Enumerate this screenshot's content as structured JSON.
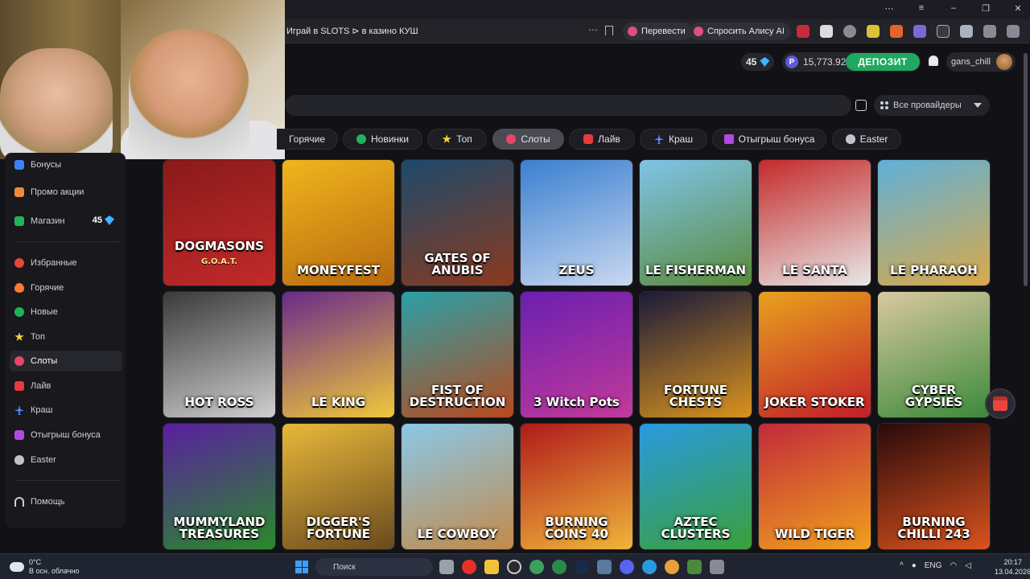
{
  "browser": {
    "tab_title": "Играй в SLOTS ⊳ в казино КУШ",
    "translate_label": "Перевести",
    "alice_label": "Спросить Алису AI",
    "window_controls": [
      "⋯",
      "≡",
      "–",
      "❐",
      "✕"
    ]
  },
  "header": {
    "gems": "45",
    "balance": "15,773.92",
    "balance_currency_icon": "Р",
    "deposit_label": "ДЕПОЗИТ",
    "username": "gans_chill",
    "accent_color": "#1fa85f"
  },
  "search": {
    "placeholder": "",
    "providers_label": "Все провайдеры"
  },
  "tabs": [
    {
      "label": "Горячие",
      "icon": "fire-icon",
      "color": "#ff7a2f"
    },
    {
      "label": "Новинки",
      "icon": "plus-icon",
      "color": "#22b35a"
    },
    {
      "label": "Топ",
      "icon": "star-icon",
      "color": "#f5d13a"
    },
    {
      "label": "Слоты",
      "icon": "cherry-icon",
      "color": "#e8456a"
    },
    {
      "label": "Лайв",
      "icon": "cards-icon",
      "color": "#e83a3a"
    },
    {
      "label": "Краш",
      "icon": "plane-icon",
      "color": "#4b8cff"
    },
    {
      "label": "Отыгрыш бонуса",
      "icon": "gift-icon",
      "color": "#b04be0"
    },
    {
      "label": "Easter",
      "icon": "egg-icon",
      "color": "#bfc3cc"
    }
  ],
  "sidebar": {
    "items": [
      {
        "label": "Бонусы",
        "icon": "bonus-icon",
        "color": "#3b82f6"
      },
      {
        "label": "Промо акции",
        "icon": "promo-icon",
        "color": "#f08a3a"
      },
      {
        "label": "Магазин",
        "icon": "shop-icon",
        "color": "#22b35a",
        "badge": "45"
      },
      {
        "label": "Избранные",
        "icon": "heart-icon",
        "color": "#e8453c"
      },
      {
        "label": "Горячие",
        "icon": "fire-icon",
        "color": "#ff7a2f"
      },
      {
        "label": "Новые",
        "icon": "plus-icon",
        "color": "#22b35a"
      },
      {
        "label": "Топ",
        "icon": "star-icon",
        "color": "#f5d13a"
      },
      {
        "label": "Слоты",
        "icon": "cherry-icon",
        "color": "#e8456a"
      },
      {
        "label": "Лайв",
        "icon": "cards-icon",
        "color": "#e83a3a"
      },
      {
        "label": "Краш",
        "icon": "plane-icon",
        "color": "#4b8cff"
      },
      {
        "label": "Отыгрыш бонуса",
        "icon": "gift-icon",
        "color": "#b04be0"
      },
      {
        "label": "Easter",
        "icon": "egg-icon",
        "color": "#bfc3cc"
      },
      {
        "label": "Помощь",
        "icon": "headset-icon",
        "color": "#cfcfd6"
      }
    ]
  },
  "games": [
    {
      "title": "DOGMASONS",
      "sub": "G.O.A.T.",
      "bg": [
        "#8a1a1a",
        "#c22a2a"
      ]
    },
    {
      "title": "MONEYFEST",
      "sub": "",
      "bg": [
        "#f0b51c",
        "#b86a10"
      ]
    },
    {
      "title": "GATES OF ANUBIS",
      "sub": "",
      "bg": [
        "#1d4a6b",
        "#8a3a1e"
      ]
    },
    {
      "title": "ZEUS",
      "sub": "",
      "bg": [
        "#3a7fd0",
        "#c9d8f0"
      ]
    },
    {
      "title": "LE FISHERMAN",
      "sub": "",
      "bg": [
        "#7fc4e8",
        "#5a8a3a"
      ]
    },
    {
      "title": "LE SANTA",
      "sub": "",
      "bg": [
        "#c42a2a",
        "#e8e8e8"
      ]
    },
    {
      "title": "LE PHARAOH",
      "sub": "",
      "bg": [
        "#5fb0d8",
        "#d9a94a"
      ]
    },
    {
      "title": "HOT ROSS",
      "sub": "",
      "bg": [
        "#3a3a3a",
        "#cfcfcf"
      ]
    },
    {
      "title": "LE KING",
      "sub": "",
      "bg": [
        "#6a2a8a",
        "#f0c83a"
      ]
    },
    {
      "title": "FIST OF DESTRUCTION",
      "sub": "",
      "bg": [
        "#2aa0a8",
        "#b84a1e"
      ]
    },
    {
      "title": "3 Witch Pots",
      "sub": "",
      "bg": [
        "#6a1fb0",
        "#c23a9a"
      ]
    },
    {
      "title": "FORTUNE CHESTS",
      "sub": "",
      "bg": [
        "#1a1a3a",
        "#d9931e"
      ]
    },
    {
      "title": "JOKER STOKER",
      "sub": "",
      "bg": [
        "#e8a21e",
        "#c21e2a"
      ]
    },
    {
      "title": "CYBER GYPSIES",
      "sub": "",
      "bg": [
        "#d9c8a0",
        "#3a8a3a"
      ]
    },
    {
      "title": "MUMMYLAND TREASURES",
      "sub": "",
      "bg": [
        "#5a1fa0",
        "#2a8a2a"
      ]
    },
    {
      "title": "DIGGER'S FORTUNE",
      "sub": "",
      "bg": [
        "#e8b83a",
        "#6a4a1e"
      ]
    },
    {
      "title": "LE COWBOY",
      "sub": "",
      "bg": [
        "#8ac8e8",
        "#c28a4a"
      ]
    },
    {
      "title": "BURNING COINS 40",
      "sub": "",
      "bg": [
        "#b01a1a",
        "#f0b53a"
      ]
    },
    {
      "title": "AZTEC CLUSTERS",
      "sub": "",
      "bg": [
        "#2a9ae0",
        "#3aa03a"
      ]
    },
    {
      "title": "WILD TIGER",
      "sub": "",
      "bg": [
        "#c22a3a",
        "#f0a01e"
      ]
    },
    {
      "title": "BURNING CHILLI 243",
      "sub": "",
      "bg": [
        "#2a0a0a",
        "#d9531e"
      ]
    }
  ],
  "taskbar": {
    "temperature": "0°C",
    "weather": "В осн. облачно",
    "search_label": "Поиск",
    "lang": "ENG",
    "time": "20:17",
    "date": "13.04.2026"
  }
}
